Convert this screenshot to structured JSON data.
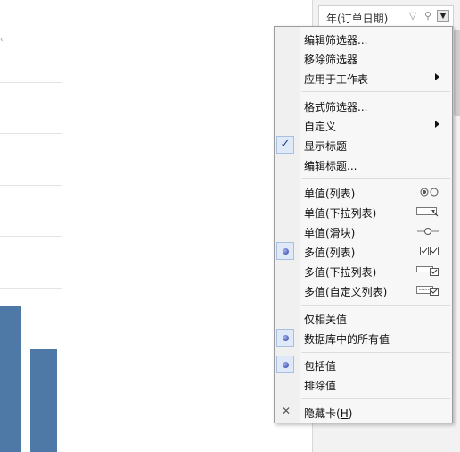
{
  "filter_card": {
    "title": "年(订单日期)"
  },
  "menu": {
    "groups": [
      [
        {
          "label": "编辑筛选器...",
          "submenu": false
        },
        {
          "label": "移除筛选器",
          "submenu": false
        },
        {
          "label": "应用于工作表",
          "submenu": true
        }
      ],
      [
        {
          "label": "格式筛选器...",
          "submenu": false
        },
        {
          "label": "自定义",
          "submenu": true
        },
        {
          "label": "显示标题",
          "checked": true
        },
        {
          "label": "编辑标题...",
          "submenu": false
        }
      ],
      [
        {
          "label": "单值(列表)",
          "glyph": "radio-pair-glyph"
        },
        {
          "label": "单值(下拉列表)",
          "glyph": "dropdown-glyph"
        },
        {
          "label": "单值(滑块)",
          "glyph": "slider-glyph"
        },
        {
          "label": "多值(列表)",
          "glyph": "checkbox-pair-glyph",
          "selected": true
        },
        {
          "label": "多值(下拉列表)",
          "glyph": "check-dropdown-glyph"
        },
        {
          "label": "多值(自定义列表)",
          "glyph": "custom-list-glyph"
        }
      ],
      [
        {
          "label": "仅相关值"
        },
        {
          "label": "数据库中的所有值",
          "selected": true
        }
      ],
      [
        {
          "label": "包括值",
          "selected": true
        },
        {
          "label": "排除值"
        }
      ],
      [
        {
          "label_prefix": "隐藏卡(",
          "label_hotkey": "H",
          "label_suffix": ")",
          "icon": "close-icon"
        }
      ]
    ]
  },
  "chart_data": {
    "type": "bar",
    "categories": [],
    "values": [],
    "bar_color": "#4e79a7"
  },
  "colors": {
    "bar": "#4e79a7",
    "menu_bg": "#f7f7f7",
    "pane_bg": "#f2f2f2"
  }
}
